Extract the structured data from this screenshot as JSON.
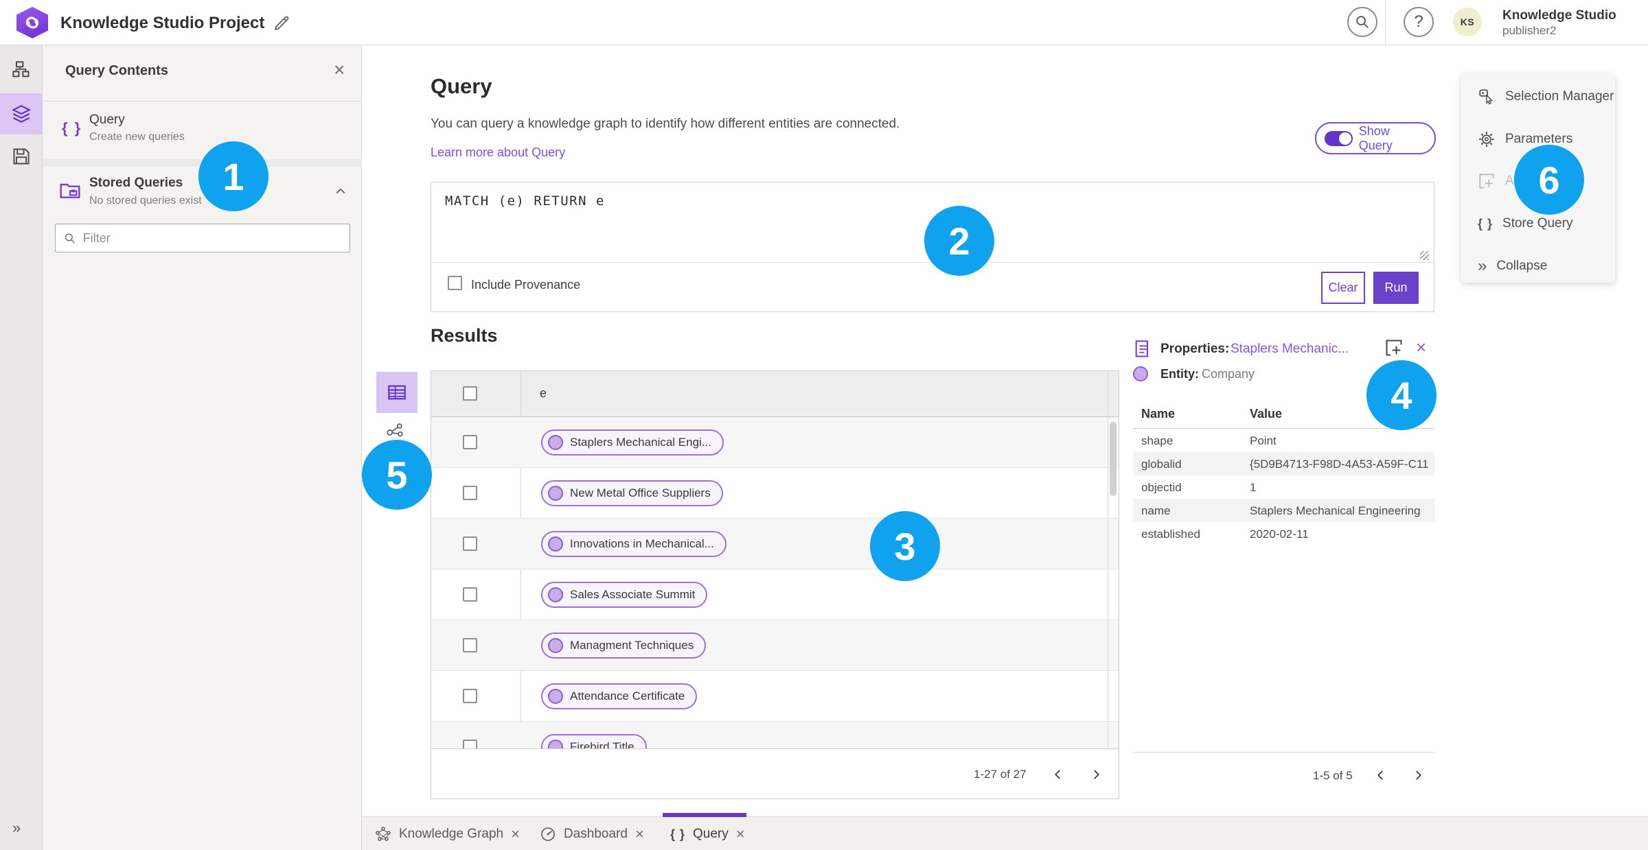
{
  "colors": {
    "accent_purple": "#6b40ca",
    "annotation_blue": "#0fa2ee",
    "chip_border": "#9a72dd",
    "active_rail_bg": "#dcc6f6"
  },
  "top_bar": {
    "project_title": "Knowledge Studio Project",
    "user": {
      "name": "Knowledge Studio",
      "role": "publisher2",
      "initials": "KS"
    }
  },
  "query_contents_panel": {
    "title": "Query Contents",
    "close_label": "×",
    "query_item": {
      "title": "Query",
      "subtitle": "Create new queries",
      "icon_text": "{ }"
    },
    "stored_queries": {
      "title": "Stored Queries",
      "subtitle": "No stored queries exist"
    },
    "filter_placeholder": "Filter"
  },
  "query_editor": {
    "heading": "Query",
    "description": "You can query a knowledge graph to identify how different entities are connected.",
    "learn_more_link": "Learn more about Query",
    "show_query_label": "Show Query",
    "query_text": "MATCH (e) RETURN e",
    "include_provenance_label": "Include Provenance",
    "clear_button": "Clear",
    "run_button": "Run"
  },
  "results": {
    "heading": "Results",
    "column_header": "e",
    "rows": [
      {
        "label": "Staplers Mechanical Engi..."
      },
      {
        "label": "New Metal Office Suppliers"
      },
      {
        "label": "Innovations in Mechanical..."
      },
      {
        "label": "Sales Associate Summit"
      },
      {
        "label": "Managment Techniques"
      },
      {
        "label": "Attendance Certificate"
      },
      {
        "label": "Firebird Title"
      }
    ],
    "pagination": "1-27 of 27"
  },
  "properties_panel": {
    "label": "Properties:",
    "entity_link": "Staplers Mechanic...",
    "entity_label": "Entity:",
    "entity_type": "Company",
    "close_label": "×",
    "name_header": "Name",
    "value_header": "Value",
    "rows": [
      {
        "name": "shape",
        "value": "Point"
      },
      {
        "name": "globalid",
        "value": "{5D9B4713-F98D-4A53-A59F-C11..."
      },
      {
        "name": "objectid",
        "value": "1"
      },
      {
        "name": "name",
        "value": "Staplers Mechanical Engineering"
      },
      {
        "name": "established",
        "value": "2020-02-11"
      }
    ],
    "pagination": "1-5 of 5"
  },
  "tools_menu": {
    "items": [
      {
        "label": "Selection Manager"
      },
      {
        "label": "Parameters"
      },
      {
        "label": "Ad"
      },
      {
        "label": "Store Query"
      },
      {
        "label": "Collapse"
      }
    ],
    "query_icon_text": "{ }",
    "collapse_icon_text": "»"
  },
  "rail": {
    "expand_icon_text": "»"
  },
  "bottom_tabs": [
    {
      "label": "Knowledge Graph",
      "close": "×"
    },
    {
      "label": "Dashboard",
      "close": "×"
    },
    {
      "label": "Query",
      "close": "×",
      "icon_text": "{ }"
    }
  ],
  "annotations": [
    "1",
    "2",
    "3",
    "4",
    "5",
    "6"
  ]
}
